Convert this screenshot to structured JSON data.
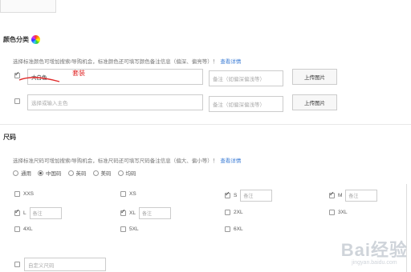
{
  "color_section": {
    "title": "颜色分类",
    "hint": "选择标准颜色可增加搜索/导购机会，标准颜色还可填写颜色备注信息（偏深、偏亮等）！",
    "detail_link": "查看详情",
    "row1": {
      "value": "大白色",
      "checked": true,
      "note_placeholder": "备注（如偏深偏浅等）",
      "upload_label": "上传图片"
    },
    "row2": {
      "placeholder": "选择或输入主色",
      "checked": false,
      "note_placeholder": "备注（如偏深偏浅等）",
      "upload_label": "上传图片"
    },
    "annotation": "套装",
    "annotation_color": "#e02a2a"
  },
  "size_section": {
    "title": "尺码",
    "hint": "选择标准尺码可增加搜索/导购机会，标准尺码还可填写尺码备注信息（偏大、偏小等）！",
    "detail_link": "查看详情",
    "systems": [
      {
        "label": "通用",
        "selected": false
      },
      {
        "label": "中国码",
        "selected": true
      },
      {
        "label": "英码",
        "selected": false
      },
      {
        "label": "美码",
        "selected": false
      },
      {
        "label": "均码",
        "selected": false
      }
    ],
    "note_placeholder": "备注",
    "sizes": [
      {
        "label": "XXS",
        "checked": false
      },
      {
        "label": "XS",
        "checked": false
      },
      {
        "label": "S",
        "checked": true
      },
      {
        "label": "M",
        "checked": true
      },
      {
        "label": "L",
        "checked": true
      },
      {
        "label": "XL",
        "checked": true
      },
      {
        "label": "2XL",
        "checked": false
      },
      {
        "label": "3XL",
        "checked": false
      },
      {
        "label": "4XL",
        "checked": false
      },
      {
        "label": "5XL",
        "checked": false
      },
      {
        "label": "6XL",
        "checked": false
      }
    ],
    "custom_placeholder": "自定义尺码"
  },
  "watermark": {
    "logo": "Bai经验",
    "url": "jingyan.baidu.com"
  },
  "accent_link_color": "#3a7bd5"
}
